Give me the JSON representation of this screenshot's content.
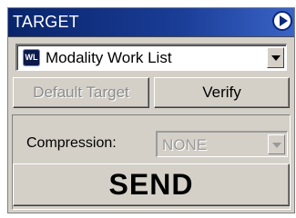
{
  "panel": {
    "title": "TARGET",
    "collapse_icon": "collapse-arrow-icon"
  },
  "target_select": {
    "icon_label": "WL",
    "icon": "worklist-icon",
    "value": "Modality Work List"
  },
  "buttons": {
    "default_target": "Default Target",
    "verify": "Verify",
    "send": "SEND"
  },
  "compression": {
    "label": "Compression:",
    "value": "NONE",
    "enabled": false
  },
  "colors": {
    "titlebar": "#08246b",
    "face": "#d4d0c8",
    "disabled_text": "#8c8c8c"
  }
}
